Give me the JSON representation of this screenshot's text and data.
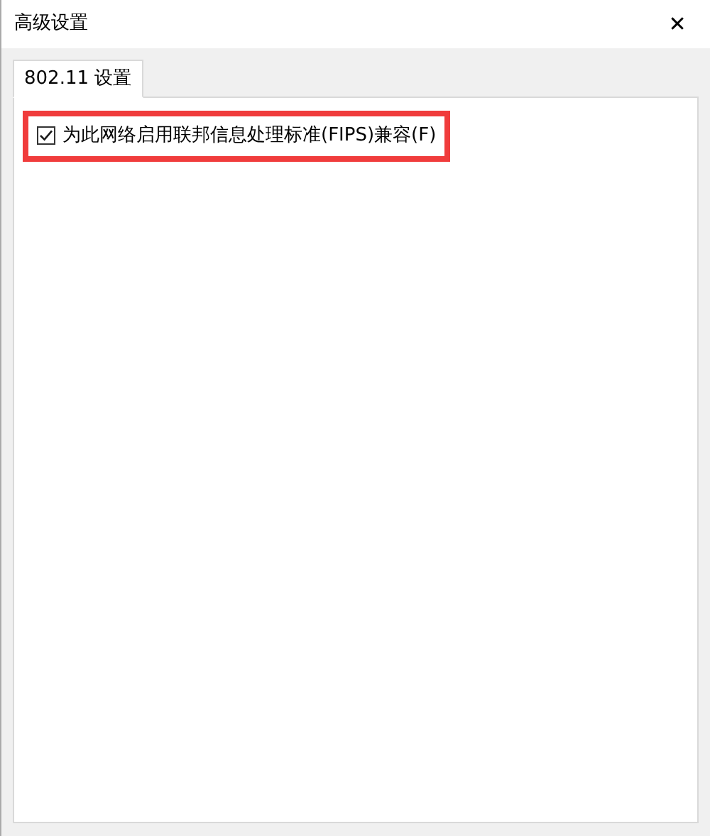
{
  "window": {
    "title": "高级设置",
    "close": "✕"
  },
  "tabs": [
    {
      "label": "802.11 设置",
      "selected": true
    }
  ],
  "options": [
    {
      "label": "为此网络启用联邦信息处理标准(FIPS)兼容(F)",
      "checked": true,
      "highlighted": true
    }
  ]
}
